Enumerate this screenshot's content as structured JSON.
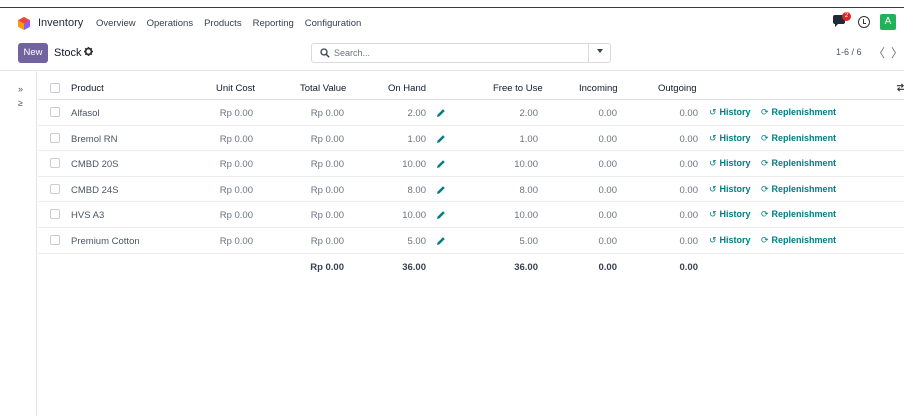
{
  "navbar": {
    "app_name": "Inventory",
    "menu": [
      "Overview",
      "Operations",
      "Products",
      "Reporting",
      "Configuration"
    ],
    "chat_badge": "2",
    "avatar_letter": "A",
    "icons": [
      "inventory-logo-icon",
      "chat-icon",
      "clock-icon"
    ]
  },
  "control": {
    "new_label": "New",
    "breadcrumb": "Stock",
    "search_placeholder": "Search...",
    "pager": "1-6 / 6",
    "prev": "〈",
    "next": "〉"
  },
  "side_panel": {
    "expand": "»",
    "filter": "≥"
  },
  "table": {
    "columns": [
      "Product",
      "Unit Cost",
      "Total Value",
      "On Hand",
      "Free to Use",
      "Incoming",
      "Outgoing"
    ],
    "history_label": "History",
    "replenish_label": "Replenishment",
    "rows": [
      {
        "product": "Alfasol",
        "unit_cost": "Rp 0.00",
        "total_value": "Rp 0.00",
        "on_hand": "2.00",
        "free": "2.00",
        "incoming": "0.00",
        "outgoing": "0.00"
      },
      {
        "product": "Bremol RN",
        "unit_cost": "Rp 0.00",
        "total_value": "Rp 0.00",
        "on_hand": "1.00",
        "free": "1.00",
        "incoming": "0.00",
        "outgoing": "0.00"
      },
      {
        "product": "CMBD 20S",
        "unit_cost": "Rp 0.00",
        "total_value": "Rp 0.00",
        "on_hand": "10.00",
        "free": "10.00",
        "incoming": "0.00",
        "outgoing": "0.00"
      },
      {
        "product": "CMBD 24S",
        "unit_cost": "Rp 0.00",
        "total_value": "Rp 0.00",
        "on_hand": "8.00",
        "free": "8.00",
        "incoming": "0.00",
        "outgoing": "0.00"
      },
      {
        "product": "HVS A3",
        "unit_cost": "Rp 0.00",
        "total_value": "Rp 0.00",
        "on_hand": "10.00",
        "free": "10.00",
        "incoming": "0.00",
        "outgoing": "0.00"
      },
      {
        "product": "Premium Cotton",
        "unit_cost": "Rp 0.00",
        "total_value": "Rp 0.00",
        "on_hand": "5.00",
        "free": "5.00",
        "incoming": "0.00",
        "outgoing": "0.00"
      }
    ],
    "totals": {
      "total_value": "Rp 0.00",
      "on_hand": "36.00",
      "free": "36.00",
      "incoming": "0.00",
      "outgoing": "0.00"
    }
  },
  "colors": {
    "primary": "#71639e",
    "link": "#017e84",
    "badge": "#e02424",
    "avatar": "#21b35a"
  }
}
